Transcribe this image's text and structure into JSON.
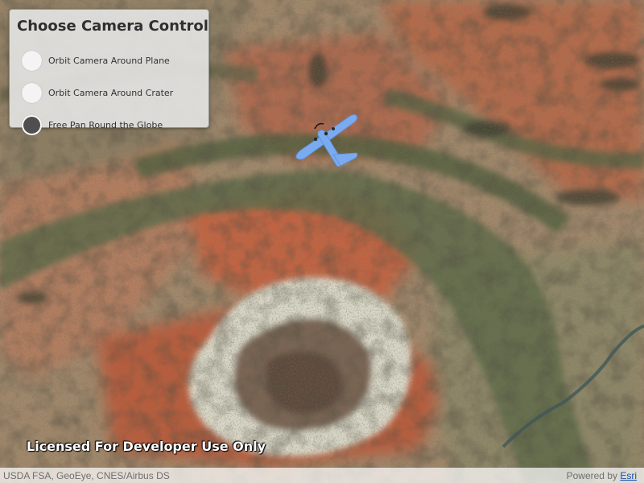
{
  "panel": {
    "title": "Choose Camera Control",
    "options": [
      {
        "label": "Orbit Camera Around Plane",
        "selected": false
      },
      {
        "label": "Orbit Camera Around Crater",
        "selected": false
      },
      {
        "label": "Free Pan Round the Globe",
        "selected": true
      }
    ]
  },
  "watermark": "Licensed For Developer Use Only",
  "attribution": {
    "sources": "USDA FSA, GeoEye, CNES/Airbus DS",
    "powered_by": "Powered by",
    "esri_link": "Esri"
  },
  "colors": {
    "plane": "#7aabf0",
    "selected_radio": "#4f4f4f",
    "link": "#1a4fb0"
  },
  "icons": {
    "plane": "airplane-icon"
  }
}
